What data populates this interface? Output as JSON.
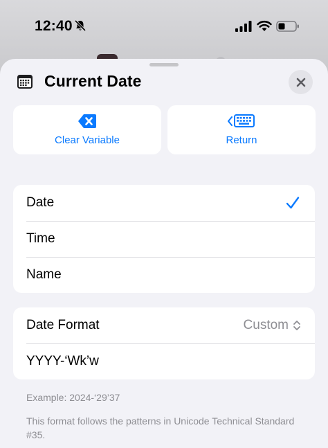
{
  "status_bar": {
    "time": "12:40",
    "icons": [
      "bell-slash-icon",
      "cellular-signal-icon",
      "wifi-icon",
      "battery-icon"
    ]
  },
  "sheet": {
    "title": "Current Date",
    "title_icon": "calendar-icon",
    "close_icon": "close-icon"
  },
  "actions": [
    {
      "label": "Clear Variable",
      "icon": "clear-delete-icon"
    },
    {
      "label": "Return",
      "icon": "keyboard-return-icon"
    }
  ],
  "options": [
    {
      "label": "Date",
      "selected": true
    },
    {
      "label": "Time",
      "selected": false
    },
    {
      "label": "Name",
      "selected": false
    }
  ],
  "format": {
    "label": "Date Format",
    "value": "Custom",
    "custom_pattern": "YYYY-‘Wk’w"
  },
  "example": "Example: 2024-‘29’37",
  "footnote": "This format follows the patterns in Unicode Technical Standard #35.",
  "colors": {
    "accent": "#0a7aff",
    "secondary_text": "#8e8e93",
    "sheet_bg": "#f2f2f7",
    "card_bg": "#ffffff"
  }
}
